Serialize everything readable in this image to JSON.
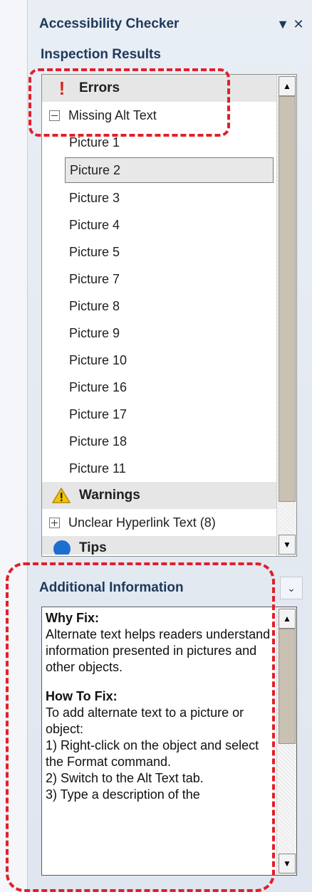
{
  "pane": {
    "title": "Accessibility Checker",
    "dropdown_glyph": "▼",
    "close_glyph": "✕"
  },
  "inspection": {
    "heading": "Inspection Results",
    "errors": {
      "label": "Errors",
      "icon": "exclamation-icon",
      "category": "Missing Alt Text",
      "items": [
        "Picture 1",
        "Picture 2",
        "Picture 3",
        "Picture 4",
        "Picture 5",
        "Picture 7",
        "Picture 8",
        "Picture 9",
        "Picture 10",
        "Picture 16",
        "Picture 17",
        "Picture 18",
        "Picture 11"
      ],
      "selected_item": "Picture 2"
    },
    "warnings": {
      "label": "Warnings",
      "icon": "warning-triangle-icon",
      "category": "Unclear Hyperlink Text (8)"
    },
    "tips": {
      "label": "Tips",
      "icon": "info-icon"
    }
  },
  "additional": {
    "heading": "Additional Information",
    "why_heading": "Why Fix:",
    "why_text": "Alternate text helps readers understand information presented in pictures and other objects.",
    "how_heading": "How To Fix:",
    "how_intro": "To add alternate text to a picture or object:",
    "steps": [
      "1) Right-click on the object and select the Format command.",
      "2) Switch to the Alt Text tab.",
      "3) Type a description of the"
    ]
  },
  "colors": {
    "callout": "#e0202a",
    "header_text": "#1e395b",
    "error_icon": "#d22b1f",
    "warning_icon": "#f5c400"
  }
}
